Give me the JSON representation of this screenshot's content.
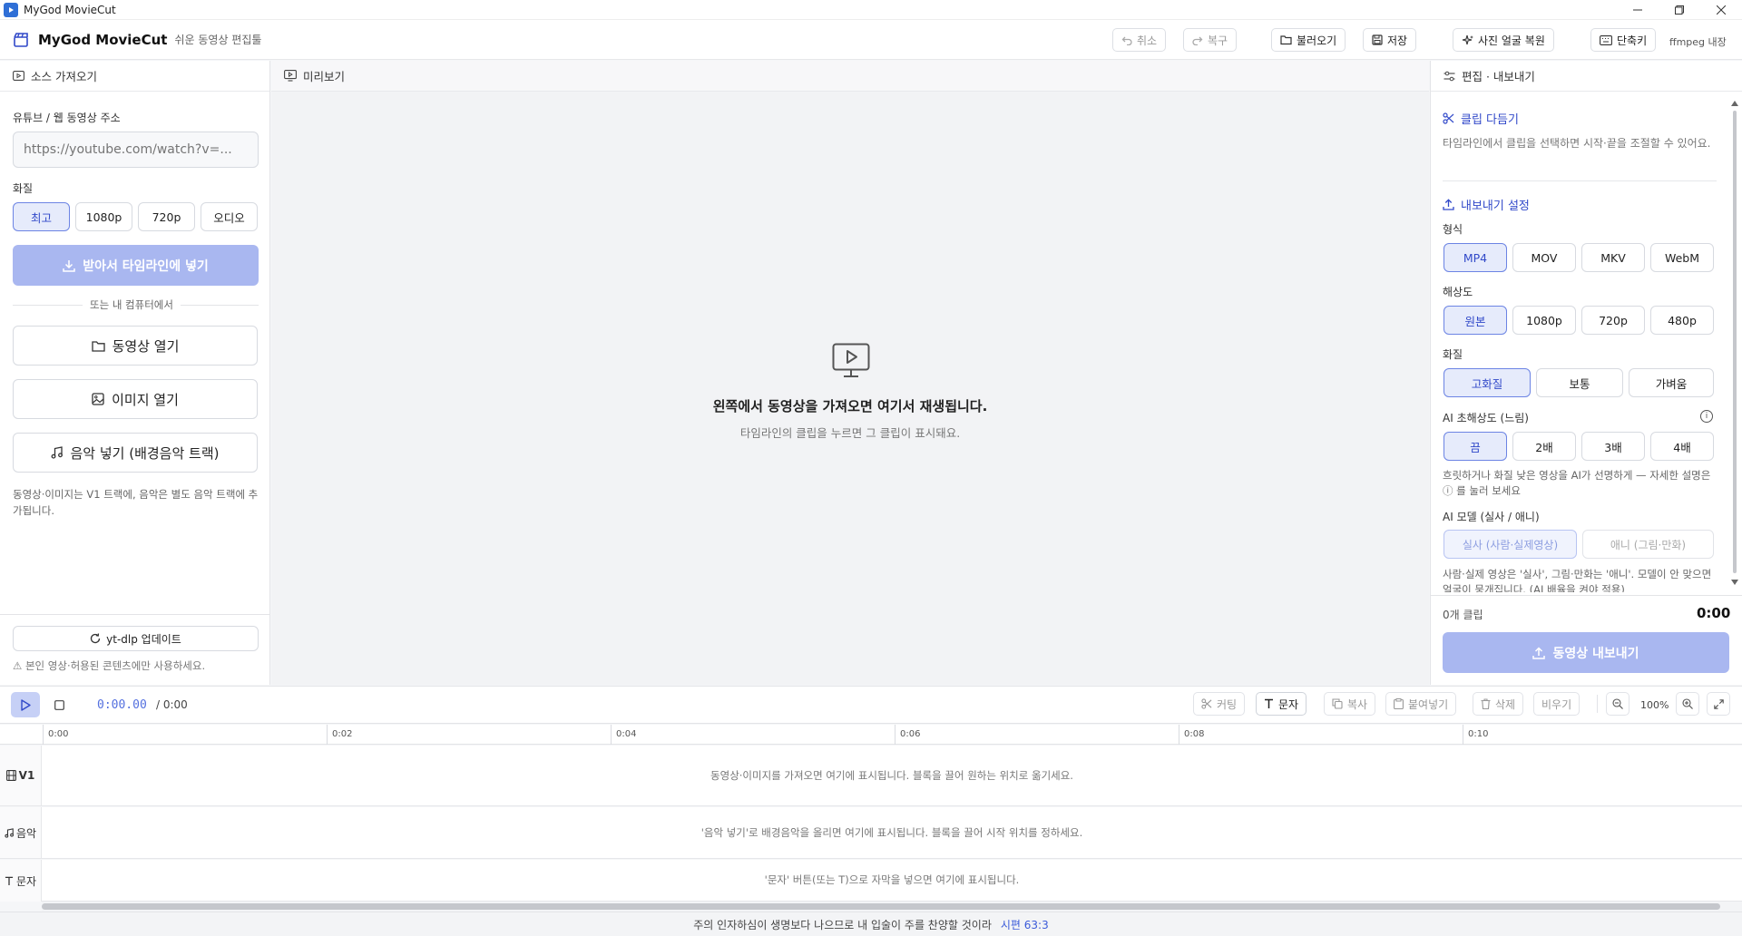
{
  "window": {
    "title": "MyGod MovieCut"
  },
  "header": {
    "app_name": "MyGod MovieCut",
    "tagline": "쉬운 동영상 편집툴",
    "undo": "취소",
    "redo": "복구",
    "load": "불러오기",
    "save": "저장",
    "face_restore": "사진 얼굴 복원",
    "shortcuts": "단축키",
    "ffmpeg": "ffmpeg 내장"
  },
  "left": {
    "title": "소스 가져오기",
    "url_label": "유튜브 / 웹 동영상 주소",
    "url_placeholder": "https://youtube.com/watch?v=...",
    "quality_label": "화질",
    "quality_options": [
      "최고",
      "1080p",
      "720p",
      "오디오"
    ],
    "download_button": "받아서 타임라인에 넣기",
    "or_divider": "또는 내 컴퓨터에서",
    "open_video": "동영상 열기",
    "open_image": "이미지 열기",
    "add_music": "음악 넣기 (배경음악 트랙)",
    "note": "동영상·이미지는 V1 트랙에, 음악은 별도 음악 트랙에 추가됩니다.",
    "ytdlp_update": "yt-dlp 업데이트",
    "warning": "⚠ 본인 영상·허용된 콘텐츠에만 사용하세요."
  },
  "preview": {
    "title": "미리보기",
    "empty_main": "왼쪽에서 동영상을 가져오면 여기서 재생됩니다.",
    "empty_sub": "타임라인의 클립을 누르면 그 클립이 표시돼요."
  },
  "right": {
    "title": "편집 · 내보내기",
    "trim_title": "클립 다듬기",
    "trim_desc": "타임라인에서 클립을 선택하면 시작·끝을 조절할 수 있어요.",
    "export_title": "내보내기 설정",
    "format_label": "형식",
    "format_options": [
      "MP4",
      "MOV",
      "MKV",
      "WebM"
    ],
    "resolution_label": "해상도",
    "resolution_options": [
      "원본",
      "1080p",
      "720p",
      "480p"
    ],
    "quality_label": "화질",
    "quality_options": [
      "고화질",
      "보통",
      "가벼움"
    ],
    "ai_upscale_label": "AI 초해상도 (느림)",
    "ai_upscale_options": [
      "끔",
      "2배",
      "3배",
      "4배"
    ],
    "ai_upscale_desc": "흐릿하거나 화질 낮은 영상을 AI가 선명하게 — 자세한 설명은 ⓘ 를 눌러 보세요",
    "ai_model_label": "AI 모델 (실사 / 애니)",
    "ai_model_options": [
      "실사 (사람·실제영상)",
      "애니 (그림·만화)"
    ],
    "ai_model_desc": "사람·실제 영상은 '실사', 그림·만화는 '애니'. 모델이 안 맞으면 얼굴이 뭉개집니다. (AI 배율을 켜야 적용)",
    "clip_count": "0개 클립",
    "duration": "0:00",
    "export_button": "동영상 내보내기"
  },
  "timeline": {
    "current_time": "0:00.00",
    "total_time": "/ 0:00",
    "tools": {
      "cut": "커팅",
      "text": "문자",
      "copy": "복사",
      "paste": "붙여넣기",
      "delete": "삭제",
      "clear": "비우기"
    },
    "zoom": "100%",
    "ticks": [
      "0:00",
      "0:02",
      "0:04",
      "0:06",
      "0:08",
      "0:10"
    ],
    "tracks": [
      {
        "label": "V1",
        "message": "동영상·이미지를 가져오면 여기에 표시됩니다. 블록을 끌어 원하는 위치로 옮기세요."
      },
      {
        "label": "음악",
        "message": "'음악 넣기'로 배경음악을 올리면 여기에 표시됩니다. 블록을 끌어 시작 위치를 정하세요."
      },
      {
        "label": "문자",
        "message": "'문자' 버튼(또는 T)으로 자막을 넣으면 여기에 표시됩니다."
      }
    ]
  },
  "footer": {
    "verse": "주의 인자하심이 생명보다 나으므로 내 입술이 주를 찬양할 것이라",
    "reference": "시편 63:3"
  },
  "colors": {
    "accent": "#3149c9",
    "accent_soft": "#e6ebfb",
    "primary_disabled": "#a9b7f0"
  }
}
